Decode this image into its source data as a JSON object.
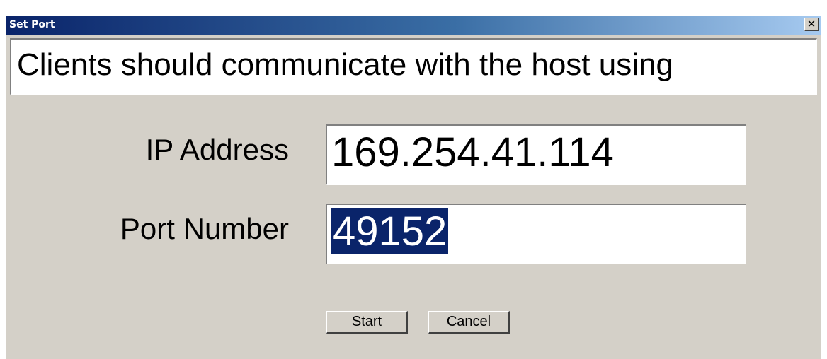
{
  "window": {
    "title": "Set Port",
    "close_glyph": "✕"
  },
  "message": "Clients should communicate with the host using",
  "form": {
    "ip_label": "IP Address",
    "ip_value": "169.254.41.114",
    "port_label": "Port Number",
    "port_value": "49152"
  },
  "buttons": {
    "start": "Start",
    "cancel": "Cancel"
  },
  "colors": {
    "title_start": "#0a246a",
    "title_end": "#a6caf0",
    "face": "#d4d0c8",
    "selection": "#0a246a"
  }
}
